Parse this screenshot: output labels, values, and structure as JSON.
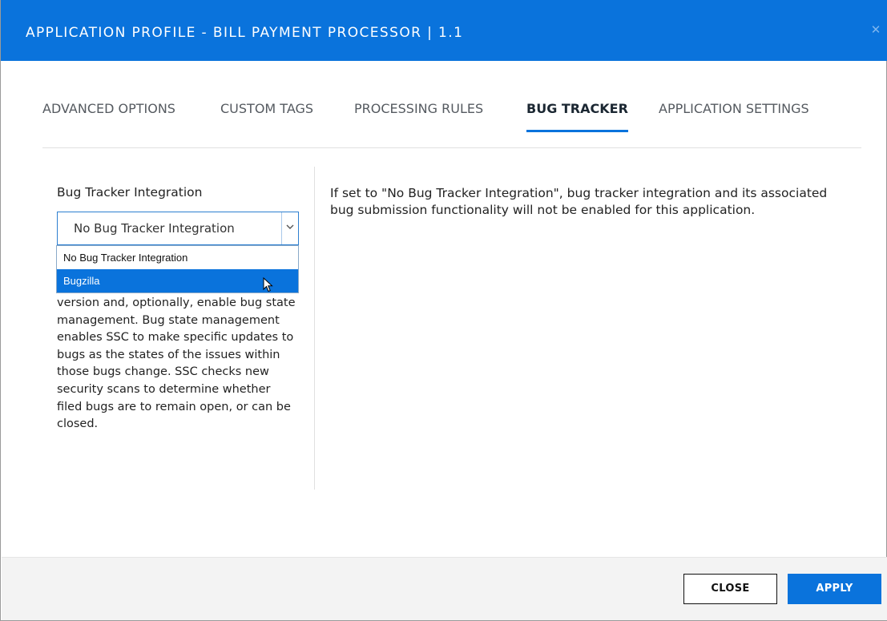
{
  "dialog": {
    "title": "APPLICATION PROFILE - BILL PAYMENT PROCESSOR | 1.1",
    "close_icon": "close-icon",
    "accent_color": "#0a73dc"
  },
  "tabs": [
    {
      "label": "ADVANCED OPTIONS",
      "active": false
    },
    {
      "label": "CUSTOM TAGS",
      "active": false
    },
    {
      "label": "PROCESSING RULES",
      "active": false
    },
    {
      "label": "BUG TRACKER",
      "active": true
    },
    {
      "label": "APPLICATION SETTINGS",
      "active": false
    }
  ],
  "bug_tracker": {
    "field_label": "Bug Tracker Integration",
    "selected_value": "No Bug Tracker Integration",
    "dropdown_icon": "chevron-down-icon",
    "options": [
      "No Bug Tracker Integration",
      "Bugzilla"
    ],
    "highlighted_option": "Bugzilla",
    "help_text": "version and, optionally, enable bug state management. Bug state management enables SSC to make specific updates to bugs as the states of the issues within those bugs change. SSC checks new security scans to determine whether filed bugs are to remain open, or can be closed.",
    "description": "If set to \"No Bug Tracker Integration\", bug tracker integration and its associated bug submission functionality will not be enabled for this application."
  },
  "footer": {
    "close_label": "CLOSE",
    "apply_label": "APPLY"
  }
}
